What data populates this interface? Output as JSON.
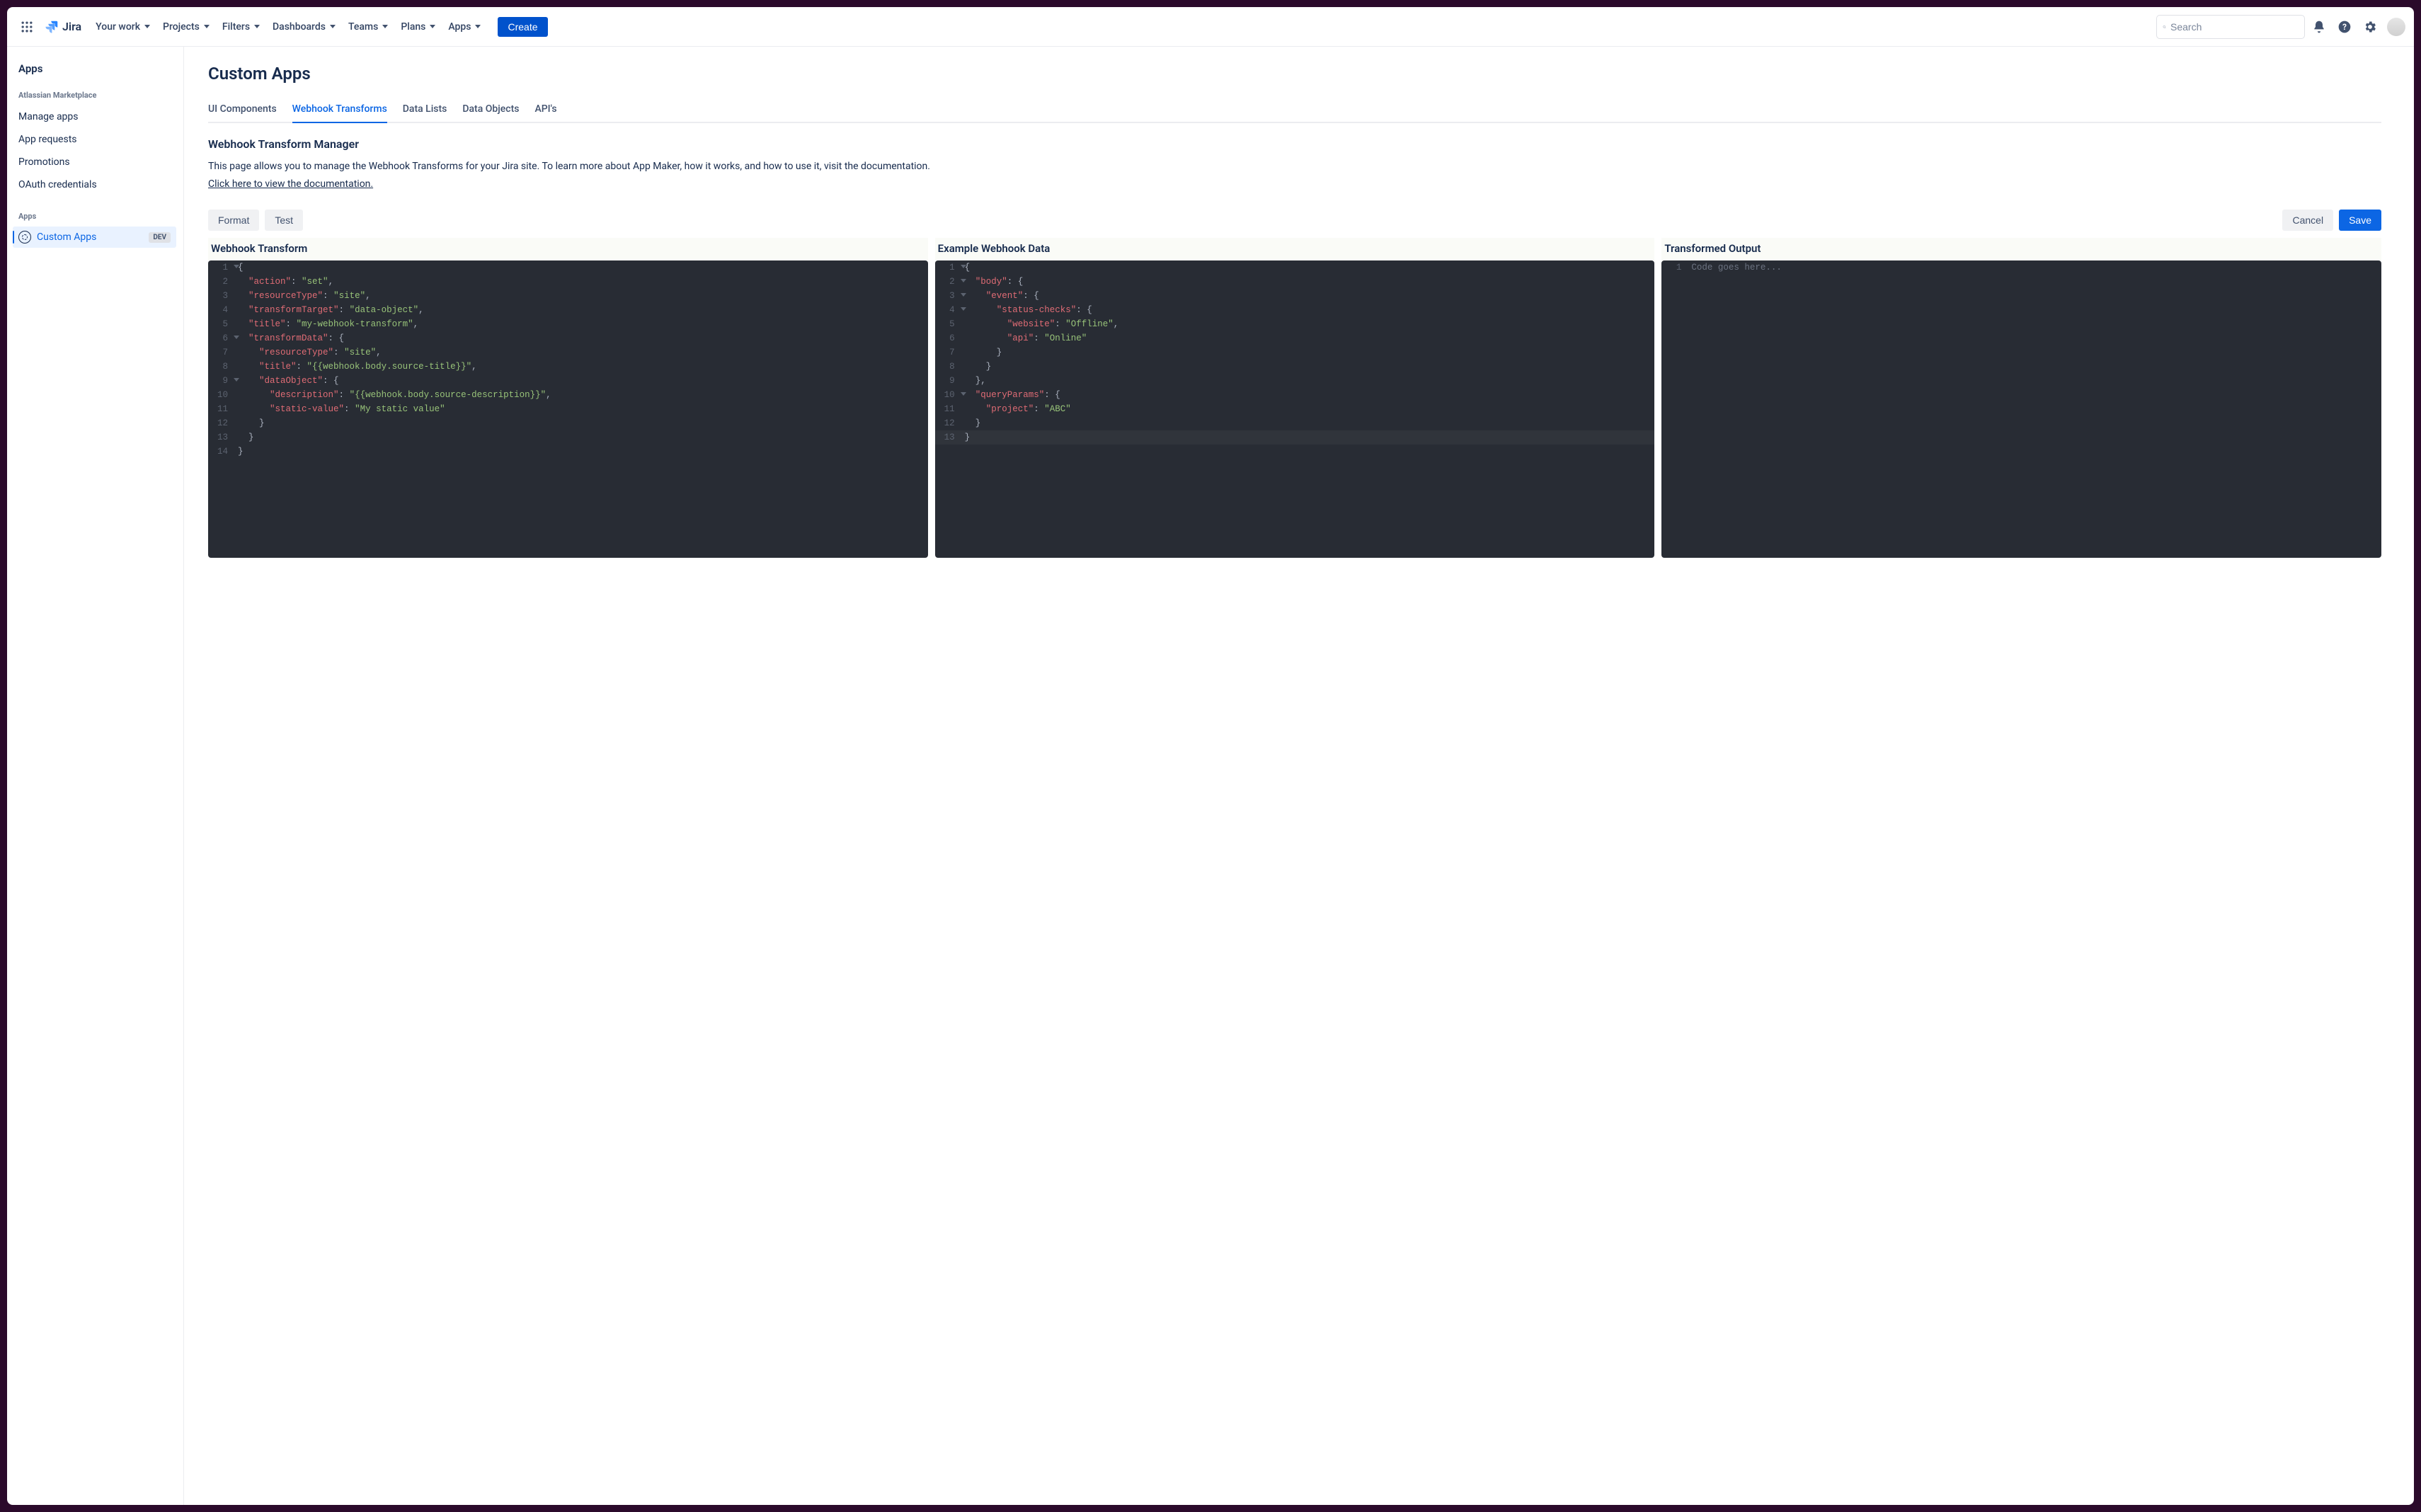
{
  "topnav": {
    "product_name": "Jira",
    "items": [
      "Your work",
      "Projects",
      "Filters",
      "Dashboards",
      "Teams",
      "Plans",
      "Apps"
    ],
    "create_label": "Create",
    "search_placeholder": "Search"
  },
  "sidebar": {
    "title": "Apps",
    "group1_label": "Atlassian Marketplace",
    "group1_items": [
      "Manage apps",
      "App requests",
      "Promotions",
      "OAuth credentials"
    ],
    "group2_label": "Apps",
    "active_item": {
      "label": "Custom Apps",
      "badge": "DEV"
    }
  },
  "page": {
    "title": "Custom Apps",
    "tabs": [
      "UI Components",
      "Webhook Transforms",
      "Data Lists",
      "Data Objects",
      "API's"
    ],
    "active_tab_index": 1,
    "section_title": "Webhook Transform Manager",
    "description": "This page allows you to manage the Webhook Transforms for your Jira site. To learn more about App Maker, how it works, and how to use it, visit the documentation.",
    "doc_link_label": "Click here to view the documentation.",
    "buttons": {
      "format": "Format",
      "test": "Test",
      "cancel": "Cancel",
      "save": "Save"
    },
    "editors": {
      "col1_title": "Webhook Transform",
      "col2_title": "Example Webhook Data",
      "col3_title": "Transformed Output",
      "col3_placeholder": "Code goes here..."
    }
  },
  "code": {
    "transform": [
      {
        "n": 1,
        "fold": true,
        "indent": 0,
        "tokens": [
          {
            "t": "punc",
            "v": "{"
          }
        ]
      },
      {
        "n": 2,
        "fold": false,
        "indent": 1,
        "tokens": [
          {
            "t": "key",
            "v": "\"action\""
          },
          {
            "t": "punc",
            "v": ": "
          },
          {
            "t": "str",
            "v": "\"set\""
          },
          {
            "t": "punc",
            "v": ","
          }
        ]
      },
      {
        "n": 3,
        "fold": false,
        "indent": 1,
        "tokens": [
          {
            "t": "key",
            "v": "\"resourceType\""
          },
          {
            "t": "punc",
            "v": ": "
          },
          {
            "t": "str",
            "v": "\"site\""
          },
          {
            "t": "punc",
            "v": ","
          }
        ]
      },
      {
        "n": 4,
        "fold": false,
        "indent": 1,
        "tokens": [
          {
            "t": "key",
            "v": "\"transformTarget\""
          },
          {
            "t": "punc",
            "v": ": "
          },
          {
            "t": "str",
            "v": "\"data-object\""
          },
          {
            "t": "punc",
            "v": ","
          }
        ]
      },
      {
        "n": 5,
        "fold": false,
        "indent": 1,
        "tokens": [
          {
            "t": "key",
            "v": "\"title\""
          },
          {
            "t": "punc",
            "v": ": "
          },
          {
            "t": "str",
            "v": "\"my-webhook-transform\""
          },
          {
            "t": "punc",
            "v": ","
          }
        ]
      },
      {
        "n": 6,
        "fold": true,
        "indent": 1,
        "tokens": [
          {
            "t": "key",
            "v": "\"transformData\""
          },
          {
            "t": "punc",
            "v": ": {"
          }
        ]
      },
      {
        "n": 7,
        "fold": false,
        "indent": 2,
        "tokens": [
          {
            "t": "key",
            "v": "\"resourceType\""
          },
          {
            "t": "punc",
            "v": ": "
          },
          {
            "t": "str",
            "v": "\"site\""
          },
          {
            "t": "punc",
            "v": ","
          }
        ]
      },
      {
        "n": 8,
        "fold": false,
        "indent": 2,
        "tokens": [
          {
            "t": "key",
            "v": "\"title\""
          },
          {
            "t": "punc",
            "v": ": "
          },
          {
            "t": "str",
            "v": "\"{{webhook.body.source-title}}\""
          },
          {
            "t": "punc",
            "v": ","
          }
        ]
      },
      {
        "n": 9,
        "fold": true,
        "indent": 2,
        "tokens": [
          {
            "t": "key",
            "v": "\"dataObject\""
          },
          {
            "t": "punc",
            "v": ": {"
          }
        ]
      },
      {
        "n": 10,
        "fold": false,
        "indent": 3,
        "tokens": [
          {
            "t": "key",
            "v": "\"description\""
          },
          {
            "t": "punc",
            "v": ": "
          },
          {
            "t": "str",
            "v": "\"{{webhook.body.source-description}}\""
          },
          {
            "t": "punc",
            "v": ","
          }
        ]
      },
      {
        "n": 11,
        "fold": false,
        "indent": 3,
        "tokens": [
          {
            "t": "key",
            "v": "\"static-value\""
          },
          {
            "t": "punc",
            "v": ": "
          },
          {
            "t": "str",
            "v": "\"My static value\""
          }
        ]
      },
      {
        "n": 12,
        "fold": false,
        "indent": 2,
        "tokens": [
          {
            "t": "punc",
            "v": "}"
          }
        ]
      },
      {
        "n": 13,
        "fold": false,
        "indent": 1,
        "tokens": [
          {
            "t": "punc",
            "v": "}"
          }
        ]
      },
      {
        "n": 14,
        "fold": false,
        "indent": 0,
        "tokens": [
          {
            "t": "punc",
            "v": "}"
          }
        ]
      }
    ],
    "example": [
      {
        "n": 1,
        "fold": true,
        "indent": 0,
        "tokens": [
          {
            "t": "punc",
            "v": "{"
          }
        ]
      },
      {
        "n": 2,
        "fold": true,
        "indent": 1,
        "tokens": [
          {
            "t": "key",
            "v": "\"body\""
          },
          {
            "t": "punc",
            "v": ": {"
          }
        ]
      },
      {
        "n": 3,
        "fold": true,
        "indent": 2,
        "tokens": [
          {
            "t": "key",
            "v": "\"event\""
          },
          {
            "t": "punc",
            "v": ": {"
          }
        ]
      },
      {
        "n": 4,
        "fold": true,
        "indent": 3,
        "tokens": [
          {
            "t": "key",
            "v": "\"status-checks\""
          },
          {
            "t": "punc",
            "v": ": {"
          }
        ]
      },
      {
        "n": 5,
        "fold": false,
        "indent": 4,
        "tokens": [
          {
            "t": "key",
            "v": "\"website\""
          },
          {
            "t": "punc",
            "v": ": "
          },
          {
            "t": "str",
            "v": "\"Offline\""
          },
          {
            "t": "punc",
            "v": ","
          }
        ]
      },
      {
        "n": 6,
        "fold": false,
        "indent": 4,
        "tokens": [
          {
            "t": "key",
            "v": "\"api\""
          },
          {
            "t": "punc",
            "v": ": "
          },
          {
            "t": "str",
            "v": "\"Online\""
          }
        ]
      },
      {
        "n": 7,
        "fold": false,
        "indent": 3,
        "tokens": [
          {
            "t": "punc",
            "v": "}"
          }
        ]
      },
      {
        "n": 8,
        "fold": false,
        "indent": 2,
        "tokens": [
          {
            "t": "punc",
            "v": "}"
          }
        ]
      },
      {
        "n": 9,
        "fold": false,
        "indent": 1,
        "tokens": [
          {
            "t": "punc",
            "v": "},"
          }
        ]
      },
      {
        "n": 10,
        "fold": true,
        "indent": 1,
        "tokens": [
          {
            "t": "key",
            "v": "\"queryParams\""
          },
          {
            "t": "punc",
            "v": ": {"
          }
        ]
      },
      {
        "n": 11,
        "fold": false,
        "indent": 2,
        "tokens": [
          {
            "t": "key",
            "v": "\"project\""
          },
          {
            "t": "punc",
            "v": ": "
          },
          {
            "t": "str",
            "v": "\"ABC\""
          }
        ]
      },
      {
        "n": 12,
        "fold": false,
        "indent": 1,
        "tokens": [
          {
            "t": "punc",
            "v": "}"
          }
        ]
      },
      {
        "n": 13,
        "fold": false,
        "indent": 0,
        "hl": true,
        "tokens": [
          {
            "t": "punc",
            "v": "}"
          }
        ]
      }
    ]
  }
}
